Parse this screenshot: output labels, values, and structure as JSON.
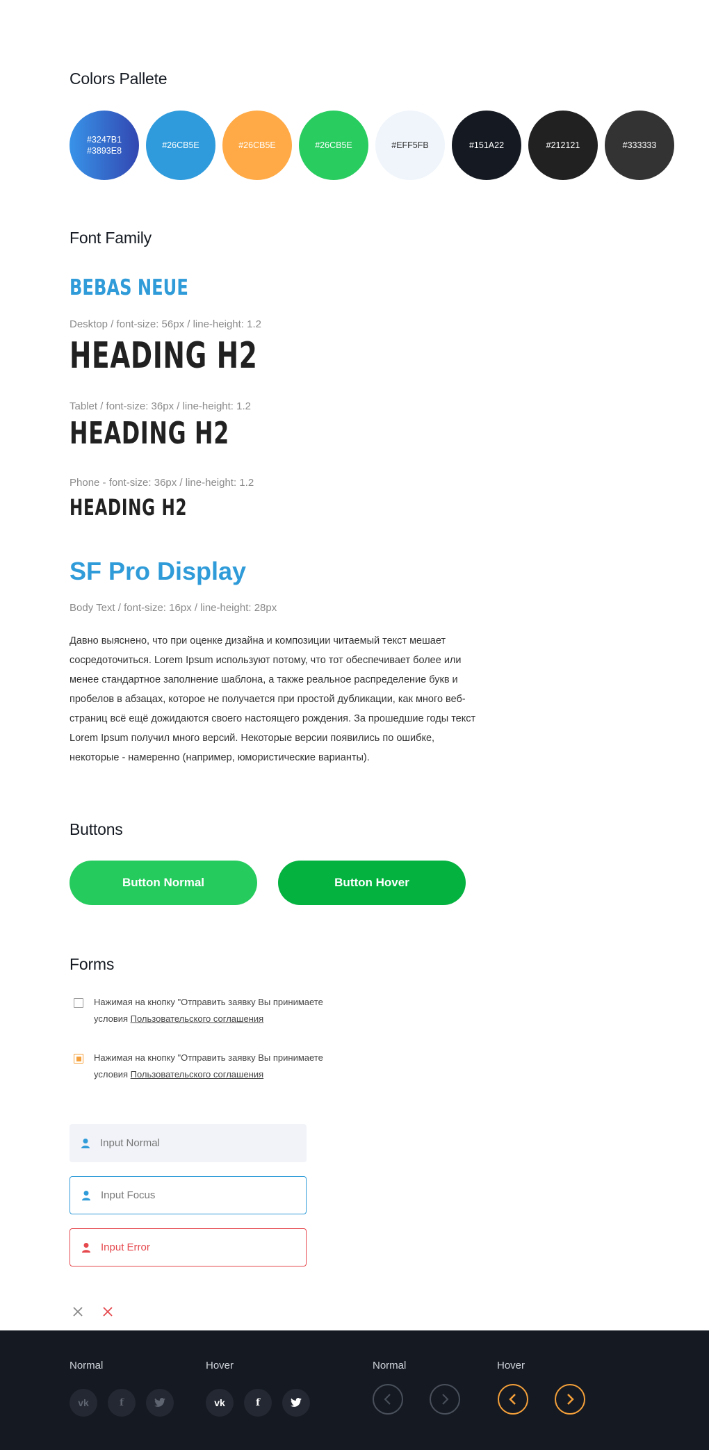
{
  "palette": {
    "title": "Colors Pallete",
    "swatches": [
      {
        "label": "#3247B1\n#3893E8",
        "bg": "linear-gradient(90deg,#3893E8,#3247B1)",
        "text": "#ffffff"
      },
      {
        "label": "#26CB5E",
        "bg": "#2F9BDC",
        "text": "#ffffff"
      },
      {
        "label": "#26CB5E",
        "bg": "#FFAA46",
        "text": "#ffffff"
      },
      {
        "label": "#26CB5E",
        "bg": "#28CC5F",
        "text": "#ffffff"
      },
      {
        "label": "#EFF5FB",
        "bg": "#EFF5FB",
        "text": "#333333"
      },
      {
        "label": "#151A22",
        "bg": "#151A22",
        "text": "#ffffff"
      },
      {
        "label": "#212121",
        "bg": "#212121",
        "text": "#ffffff"
      },
      {
        "label": "#333333",
        "bg": "#333333",
        "text": "#ffffff"
      }
    ]
  },
  "fonts": {
    "title": "Font Family",
    "bebas_name": "BEBAS NEUE",
    "desktop_spec": "Desktop / font-size: 56px / line-height: 1.2",
    "tablet_spec": "Tablet / font-size: 36px / line-height: 1.2",
    "phone_spec": "Phone - font-size: 36px / line-height: 1.2",
    "heading_text": "HEADING H2",
    "sf_name": "SF Pro Display",
    "body_spec": "Body Text / font-size: 16px / line-height: 28px",
    "body_text": "Давно выяснено, что при оценке дизайна и композиции читаемый текст мешает сосредоточиться. Lorem Ipsum используют потому, что тот обеспечивает более или менее стандартное заполнение шаблона, а также реальное распределение букв и пробелов в абзацах, которое не получается при простой дубликации, как много веб-страниц всё ещё дожидаются своего настоящего рождения. За прошедшие годы текст Lorem Ipsum получил много версий. Некоторые версии появились по ошибке, некоторые - намеренно (например, юмористические варианты)."
  },
  "buttons": {
    "title": "Buttons",
    "normal_label": "Button Normal",
    "hover_label": "Button Hover",
    "normal_color": "#26CB5E",
    "hover_color": "#04B240"
  },
  "forms": {
    "title": "Forms",
    "consent_text": "Нажимая на кнопку \"Отправить заявку Вы принимаете условия ",
    "consent_link": "Пользовательского соглашения",
    "input_normal": "Input Normal",
    "input_focus": "Input Focus",
    "input_error": "Input Error",
    "accent": "#F5A03A",
    "focus_border": "#2F9BD8",
    "error_color": "#E5484D"
  },
  "footer": {
    "social_normal_label": "Normal",
    "social_hover_label": "Hover",
    "arrows_normal_label": "Normal",
    "arrows_hover_label": "Hover",
    "social_icons": [
      "vk-icon",
      "facebook-icon",
      "twitter-icon"
    ],
    "vk_glyph": "vk",
    "fb_glyph": "f"
  }
}
